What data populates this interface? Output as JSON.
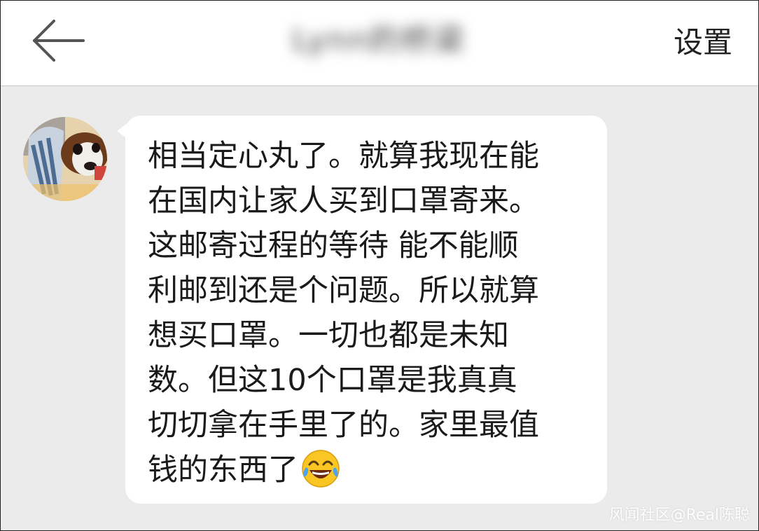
{
  "header": {
    "back_icon": "arrow-left-icon",
    "title": "Lynn的桥梁",
    "settings_label": "设置"
  },
  "chat": {
    "messages": [
      {
        "sender": "incoming",
        "avatar_icon": "dog-avatar",
        "lines": [
          "相当定心丸了。就算我现在能",
          "在国内让家人买到口罩寄来。",
          "这邮寄过程的等待 能不能顺",
          "利邮到还是个问题。所以就算",
          "想买口罩。一切也都是未知",
          "数。但这10个口罩是我真真",
          "切切拿在手里了的。家里最值",
          "钱的东西了"
        ],
        "emoji": "laughing-crying-emoji"
      }
    ]
  },
  "watermark": "风闻社区@Real陈聪",
  "colors": {
    "chat_background": "#ebebeb",
    "bubble": "#ffffff",
    "text": "#1a1a1a"
  }
}
